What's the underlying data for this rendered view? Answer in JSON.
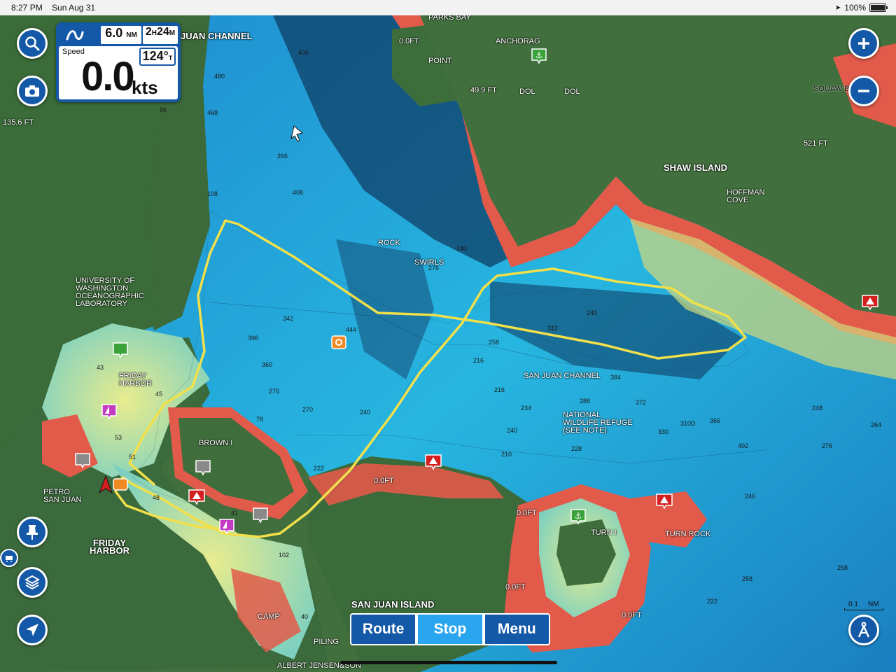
{
  "status": {
    "time": "8:27 PM",
    "date": "Sun Aug 31",
    "battery": "100%"
  },
  "instrument": {
    "distance_value": "6.0",
    "distance_unit": "NM",
    "time_hours": "2",
    "time_hours_unit": "H",
    "time_minutes": "24",
    "time_minutes_unit": "M",
    "speed_label": "Speed",
    "speed_value": "0.0",
    "speed_unit": "kts",
    "heading_value": "124°",
    "heading_ref": "T"
  },
  "bottom_bar": {
    "route": "Route",
    "stop": "Stop",
    "menu": "Menu"
  },
  "scale": {
    "value": "0.1",
    "unit": "NM"
  },
  "labels": {
    "juan_channel": "JUAN CHANNEL",
    "parks_bay": "PARKS BAY",
    "anchorage": "ANCHORAG",
    "point": "POINT",
    "dol1": "DOL",
    "dol2": "DOL",
    "squaw": "SQUAW B",
    "shaw_island": "SHAW ISLAND",
    "hoffman_cove": "HOFFMAN\nCOVE",
    "ft_521": "521 FT",
    "ft_499": "49.9 FT",
    "ft_136": "135.6 FT",
    "ft_0a": "0.0FT",
    "ft_0b": "0.0FT",
    "ft_0c": "0.0FT",
    "ft_0d": "0.0FT",
    "ft_0e": "0.0FT",
    "uw_lab": "UNIVERSITY OF\nWASHINGTON\nOCEANOGRAPHIC\nLABORATORY",
    "friday_harbor_small": "FRIDAY\nHARBOR",
    "friday_harbor_big": "FRIDAY\nHARBOR",
    "petro": "PETRO\nSAN JUAN",
    "brown": "BROWN I",
    "san_juan_channel": "SAN JUAN CHANNEL",
    "national_refuge": "NATIONAL\nWILDLIFE REFUGE\n(SEE NOTE)",
    "turn_i": "TURN I",
    "turn_rock": "TURN ROCK",
    "swirls": "SWIRLS",
    "rock": "ROCK",
    "san_juan_island": "SAN JUAN ISLAND",
    "albert": "ALBERT JENSEN&SON",
    "camp": "CAMP",
    "piling": "PILING"
  },
  "depths": [
    "480",
    "468",
    "436",
    "408",
    "266",
    "342",
    "444",
    "396",
    "360",
    "276",
    "270",
    "240",
    "216",
    "258",
    "216",
    "234",
    "240",
    "210",
    "222",
    "228",
    "288",
    "384",
    "372",
    "330",
    "310D",
    "366",
    "402",
    "264",
    "276",
    "240",
    "248",
    "258",
    "222",
    "102",
    "78",
    "96",
    "108",
    "43",
    "45",
    "53",
    "51",
    "48",
    "41",
    "40",
    "276",
    "240",
    "312",
    "258",
    "246"
  ],
  "colors": {
    "deep_water": "#1d86c8",
    "mid_water": "#25b2dc",
    "shallow_water": "#d5e88a",
    "intertidal": "#e25a4a",
    "land": "#3f6e3c",
    "track": "#f2e04a",
    "ui_blue": "#1458a8",
    "ui_active": "#2aa6f0"
  }
}
